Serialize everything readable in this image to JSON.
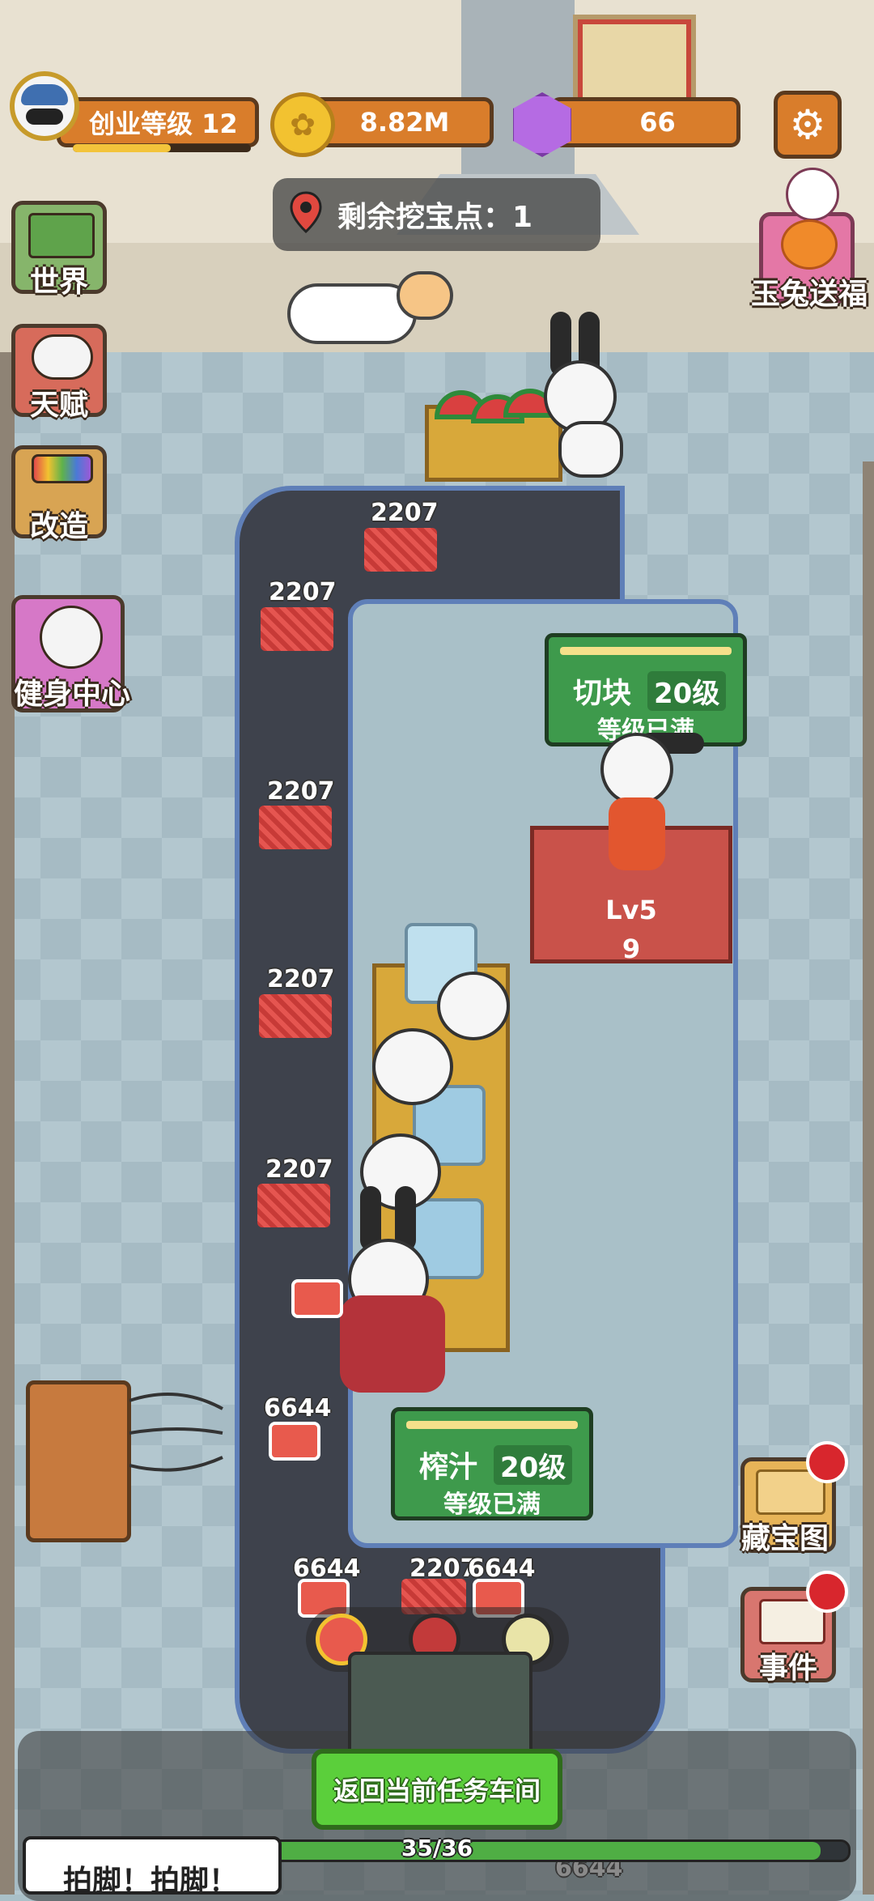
{
  "header": {
    "level_label": "创业等级 12",
    "level_progress": 0.55,
    "coins": "8.82M",
    "gems": "66"
  },
  "dig_banner": "剩余挖宝点：1",
  "left_menu": {
    "world": "世界",
    "talent": "天赋",
    "remodel": "改造",
    "gym": "健身中心"
  },
  "right_menu": {
    "rabbit_gift": "玉兔送福",
    "treasure_map": "藏宝图",
    "events": "事件"
  },
  "stations": {
    "cut": {
      "name": "切块",
      "level": "20级",
      "status": "等级已满"
    },
    "juice": {
      "name": "榨汁",
      "level": "20级",
      "status": "等级已满"
    }
  },
  "cut_table": {
    "level": "Lv5",
    "count": "9"
  },
  "belt_counts": {
    "p1": "2207",
    "p2": "2207",
    "p3": "2207",
    "p4": "2207",
    "p5": "2207",
    "j1": "6644",
    "j2": "6644",
    "j3": "2207",
    "j4": "6644",
    "j5": "6644"
  },
  "bottom": {
    "return_button": "返回当前任务车间",
    "progress_text": "35/36",
    "progress_value": 0.972,
    "chant": "拍脚！拍脚！"
  },
  "colors": {
    "accent_orange": "#d97d2b",
    "station_green": "#3e9a4c",
    "return_green": "#5bcf3b"
  }
}
